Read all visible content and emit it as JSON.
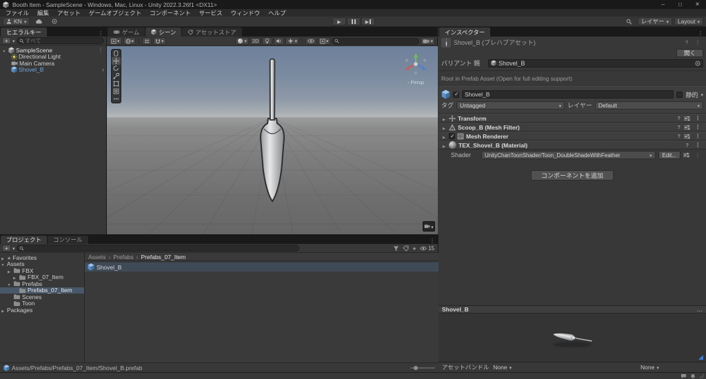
{
  "window": {
    "title": "Booth Item - SampleScene - Windows, Mac, Linux - Unity 2022.3.26f1 <DX11>"
  },
  "menubar": {
    "items": [
      {
        "label": "ファイル"
      },
      {
        "label": "編集"
      },
      {
        "label": "アセット"
      },
      {
        "label": "ゲームオブジェクト"
      },
      {
        "label": "コンポーネント"
      },
      {
        "label": "サービス"
      },
      {
        "label": "ウィンドウ"
      },
      {
        "label": "ヘルプ"
      }
    ]
  },
  "toolbar": {
    "account_label": "KN",
    "layers_label": "レイヤー",
    "layout_label": "Layout"
  },
  "hierarchy": {
    "tab_label": "ヒエラルキー",
    "search_placeholder": "すべて",
    "scene_row": {
      "label": "SampleScene"
    },
    "items": [
      {
        "label": "Directional Light"
      },
      {
        "label": "Main Camera"
      },
      {
        "label": "Shovel_B"
      }
    ]
  },
  "scene": {
    "tabs": [
      {
        "label": "ゲーム"
      },
      {
        "label": "シーン"
      },
      {
        "label": "アセットストア"
      }
    ],
    "toolbar": {
      "mode_2d": "2D"
    },
    "gizmo_label": "Persp"
  },
  "inspector": {
    "tab_label": "インスペクター",
    "asset_title": "Shovel_B (プレハブアセット)",
    "open_button": "開く",
    "variant_parent_label": "バリアント 親",
    "variant_parent_value": "Shovel_B",
    "root_notice": "Root in Prefab Asset (Open for full editing support)",
    "object": {
      "name": "Shovel_B",
      "static_label": "静的",
      "tag_label": "タグ",
      "tag_value": "Untagged",
      "layer_label": "レイヤー",
      "layer_value": "Default"
    },
    "components": [
      {
        "name": "Transform"
      },
      {
        "name": "Scoop_B (Mesh Filter)"
      },
      {
        "name": "Mesh Renderer"
      }
    ],
    "material": {
      "name": "TEX_Shovel_B (Material)",
      "shader_label": "Shader",
      "shader_value": "UnityChanToonShader/Toon_DoubleShadeWithFeather",
      "edit_button": "Edit..."
    },
    "add_component_button": "コンポーネントを追加",
    "preview": {
      "title": "Shovel_B"
    },
    "assetbundle": {
      "label": "アセットバンドル",
      "bundle_value": "None",
      "variant_value": "None"
    }
  },
  "project": {
    "tabs": [
      {
        "label": "プロジェクト"
      },
      {
        "label": "コンソール"
      }
    ],
    "hidden_count": "15",
    "tree": [
      {
        "label": "Favorites"
      },
      {
        "label": "Assets"
      },
      {
        "label": "FBX"
      },
      {
        "label": "FBX_07_Item"
      },
      {
        "label": "Prefabs"
      },
      {
        "label": "Prefabs_07_Item",
        "selected": true
      },
      {
        "label": "Scenes"
      },
      {
        "label": "Toon"
      },
      {
        "label": "Packages"
      }
    ],
    "breadcrumb": [
      {
        "label": "Assets"
      },
      {
        "label": "Prefabs"
      },
      {
        "label": "Prefabs_07_Item"
      }
    ],
    "items": [
      {
        "label": "Shovel_B",
        "selected": true
      }
    ],
    "status_path": "Assets/Prefabs/Prefabs_07_Item/Shovel_B.prefab"
  }
}
